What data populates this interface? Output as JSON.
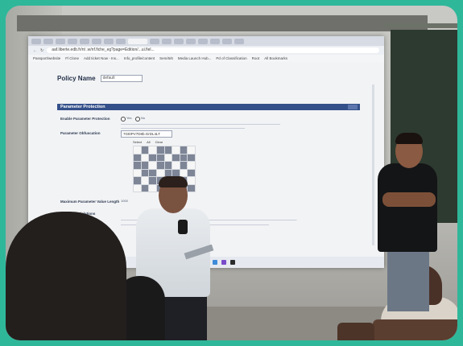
{
  "browser": {
    "address": "aaf.liberte.edb.fr/nt .w/nf.fiche_eg?page=Edition/...ui.fiel...",
    "bookmarks": [
      "Passport/website",
      "Fl Clone",
      "Add ticket Now - Ins...",
      "Info_profile/content",
      "Sem/6/6",
      "Media Launch Hub...",
      "Pd of Classification",
      "Root",
      "All Bookmarks"
    ]
  },
  "page": {
    "title": "Policy Name",
    "policy_value": "default",
    "section_title": "Parameter Protection",
    "rows": [
      {
        "label": "Enable Parameter Protection",
        "option_yes": "Yes",
        "option_no": "No"
      },
      {
        "label": "Parameter Obfuscation",
        "value": "7Gt0PV7D8b.GrDL4LT"
      },
      {
        "label": "Maximum Parameter Value Length",
        "value": "1000"
      },
      {
        "label": "Maximum Violations"
      }
    ],
    "grid_headers": [
      "Select",
      "All",
      "Clear"
    ]
  },
  "colors": {
    "section_bar": "#34508a",
    "teal_frame": "#2fb79a"
  }
}
